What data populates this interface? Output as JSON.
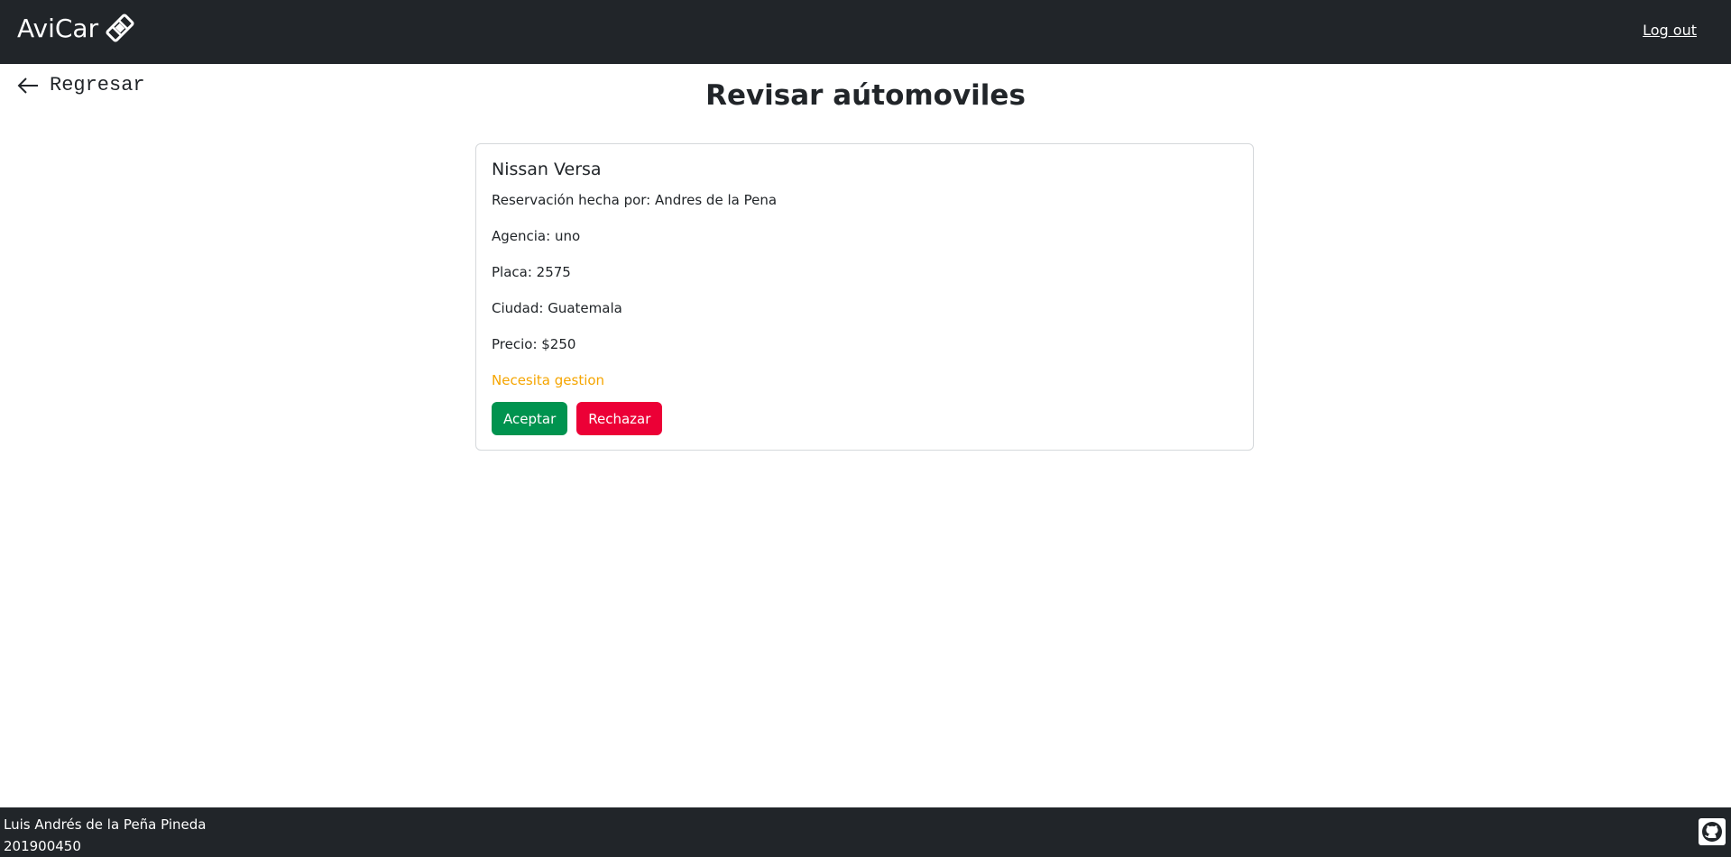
{
  "navbar": {
    "brand": "AviCar",
    "brand_icon": "ticket-icon",
    "logout_label": "Log out"
  },
  "back": {
    "label": "Regresar",
    "icon": "arrow-left-icon"
  },
  "page_title": "Revisar aútomoviles",
  "card": {
    "car_name": "Nissan Versa",
    "reserved_by": "Reservación hecha por: Andres de la Pena",
    "agency": "Agencia: uno",
    "plate": "Placa: 2575",
    "city": "Ciudad: Guatemala",
    "price": "Precio: $250",
    "status": "Necesita gestion",
    "status_color": "#f5a500",
    "accept_label": "Aceptar",
    "reject_label": "Rechazar",
    "accept_color": "#00934f",
    "reject_color": "#ec0036"
  },
  "footer": {
    "author": "Luis Andrés de la Peña Pineda",
    "student_id": "201900450",
    "github_icon": "github-icon"
  },
  "colors": {
    "navbar_bg": "#212529",
    "footer_bg": "#212529"
  }
}
